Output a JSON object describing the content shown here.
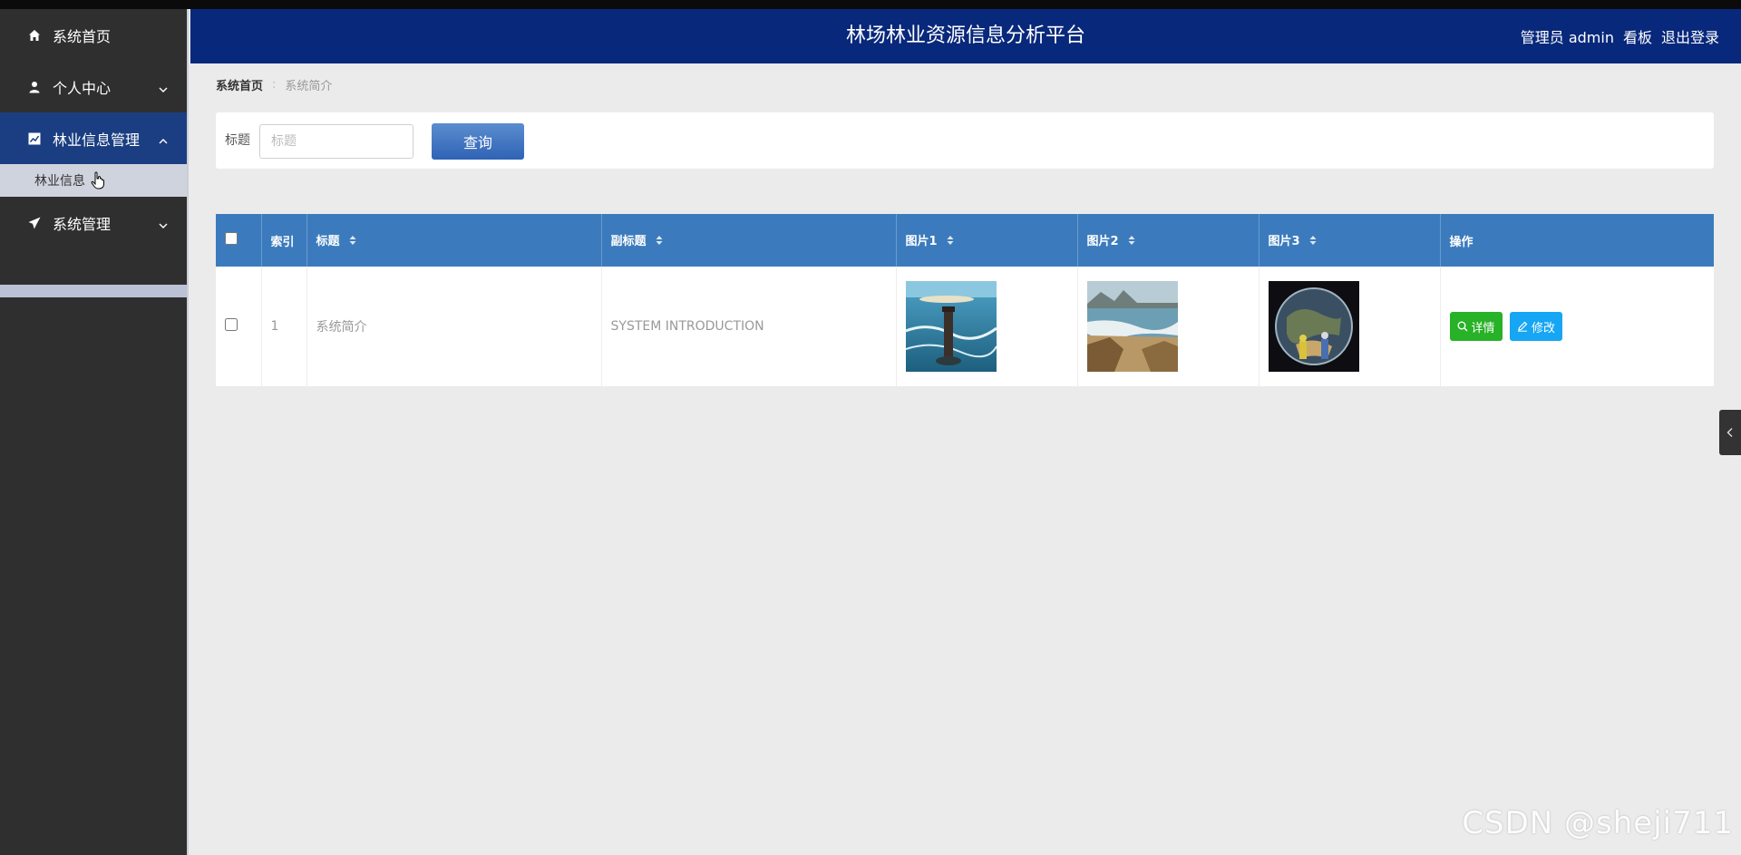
{
  "app": {
    "title": "林场林业资源信息分析平台"
  },
  "header": {
    "user_label": "管理员 admin",
    "dashboard_label": "看板",
    "logout_label": "退出登录"
  },
  "sidebar": {
    "items": [
      {
        "label": "系统首页",
        "icon": "home-icon"
      },
      {
        "label": "个人中心",
        "icon": "user-icon"
      },
      {
        "label": "林业信息管理",
        "icon": "chart-icon",
        "active": true
      },
      {
        "label": "系统管理",
        "icon": "send-icon"
      }
    ],
    "submenu": [
      {
        "label": "林业信息"
      }
    ]
  },
  "breadcrumb": {
    "home": "系统首页",
    "current": "系统简介"
  },
  "search": {
    "label": "标题",
    "placeholder": "标题",
    "button_label": "查询"
  },
  "table": {
    "headers": [
      "索引",
      "标题",
      "副标题",
      "图片1",
      "图片2",
      "图片3",
      "操作"
    ],
    "rows": [
      {
        "index": "1",
        "title": "系统简介",
        "subtitle": "SYSTEM INTRODUCTION",
        "detail_label": "详情",
        "edit_label": "修改"
      }
    ]
  },
  "watermark": "CSDN @sheji711",
  "colors": {
    "header_bg": "#08287b",
    "sidebar_bg": "#2f2f2f",
    "table_header_bg": "#3b7bbd",
    "detail_button": "#27b227",
    "edit_button": "#16a6f3"
  }
}
